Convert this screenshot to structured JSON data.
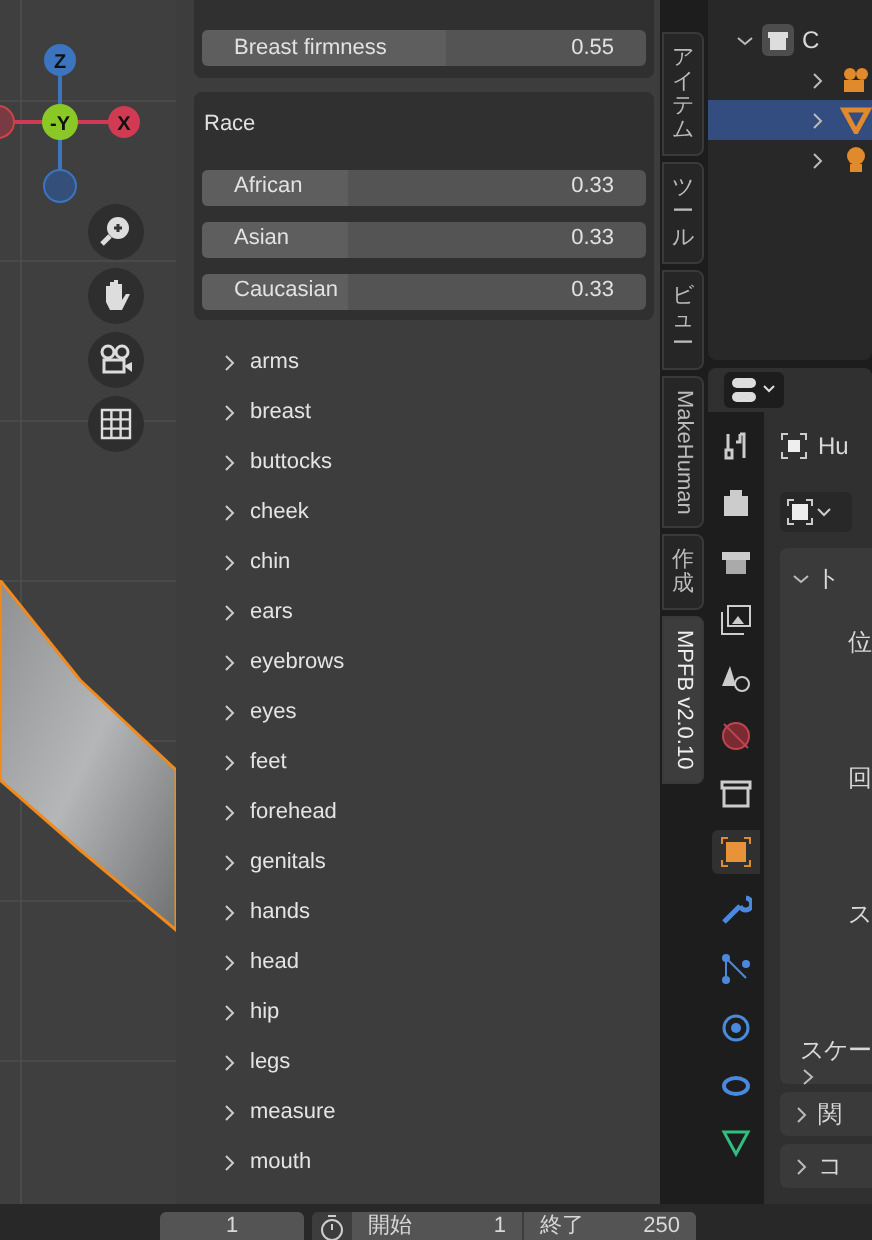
{
  "panel": {
    "top_slider": {
      "label": "Breast firmness",
      "value": "0.55",
      "level": 0.55
    },
    "race": {
      "title": "Race",
      "sliders": [
        {
          "label": "African",
          "value": "0.33",
          "level": 0.33
        },
        {
          "label": "Asian",
          "value": "0.33",
          "level": 0.33
        },
        {
          "label": "Caucasian",
          "value": "0.33",
          "level": 0.33
        }
      ]
    },
    "groups": [
      {
        "label": "arms",
        "expanded": false
      },
      {
        "label": "breast",
        "expanded": false
      },
      {
        "label": "buttocks",
        "expanded": false
      },
      {
        "label": "cheek",
        "expanded": false
      },
      {
        "label": "chin",
        "expanded": false
      },
      {
        "label": "ears",
        "expanded": false
      },
      {
        "label": "eyebrows",
        "expanded": false
      },
      {
        "label": "eyes",
        "expanded": false
      },
      {
        "label": "feet",
        "expanded": false
      },
      {
        "label": "forehead",
        "expanded": false
      },
      {
        "label": "genitals",
        "expanded": false
      },
      {
        "label": "hands",
        "expanded": false
      },
      {
        "label": "head",
        "expanded": false
      },
      {
        "label": "hip",
        "expanded": false
      },
      {
        "label": "legs",
        "expanded": false
      },
      {
        "label": "measure",
        "expanded": false
      },
      {
        "label": "mouth",
        "expanded": false
      }
    ]
  },
  "gizmo": {
    "axes": [
      "Z",
      "-Y",
      "X"
    ]
  },
  "sidebar_tabs": [
    {
      "label": "アイテム",
      "kind": "cjk",
      "selected": false
    },
    {
      "label": "ツール",
      "kind": "cjk",
      "selected": false
    },
    {
      "label": "ビュー",
      "kind": "cjk",
      "selected": false
    },
    {
      "label": "MakeHuman",
      "kind": "latin",
      "selected": false
    },
    {
      "label": "作成",
      "kind": "cjk",
      "selected": false
    },
    {
      "label": "MPFB v2.0.10",
      "kind": "latin",
      "selected": true
    }
  ],
  "outliner": {
    "collection": "C",
    "children": [
      {
        "selected": false
      },
      {
        "selected": true
      },
      {
        "selected": false
      }
    ]
  },
  "properties": {
    "object_name": "Hu",
    "panel_title": "ト",
    "rows": [
      "位",
      "回",
      "ス",
      "スケー"
    ],
    "subpanels": [
      "関",
      "コ"
    ]
  },
  "timeline": {
    "current_frame": "1",
    "start_label": "開始",
    "start": "1",
    "end_label": "終了",
    "end": "250"
  }
}
